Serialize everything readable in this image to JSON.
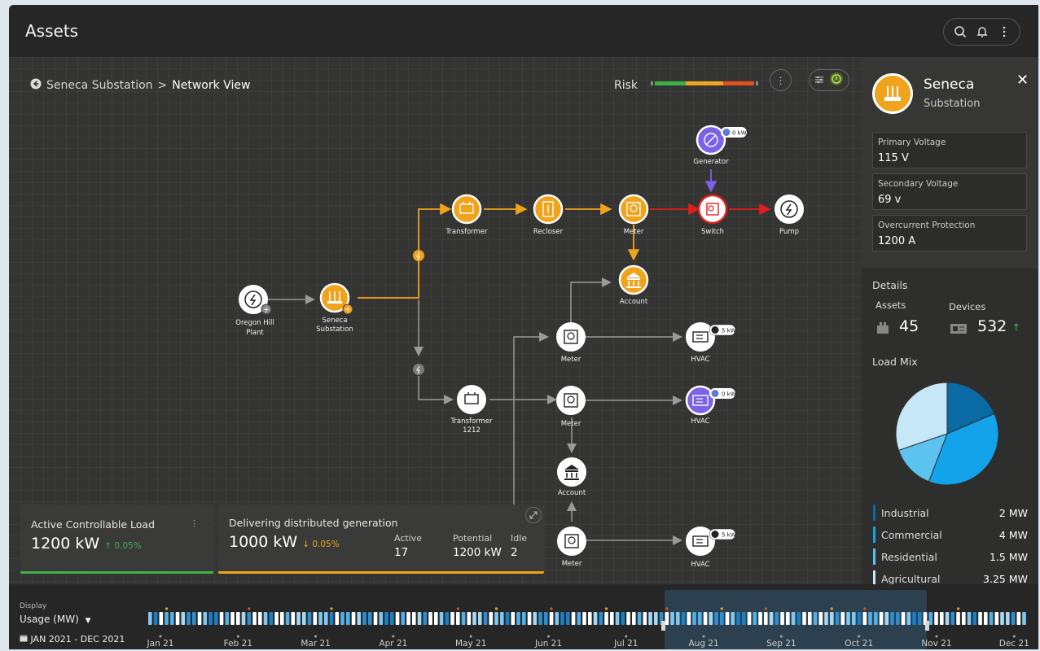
{
  "app": {
    "title": "Assets"
  },
  "breadcrumb": {
    "parent": "Seneca Substation",
    "separator": ">",
    "current": "Network View"
  },
  "risk": {
    "label": "Risk",
    "colors": [
      "#3eb049",
      "#f0a31c",
      "#e5501f"
    ]
  },
  "nodes": {
    "generator": {
      "label": "Generator",
      "badge": "0 kW"
    },
    "transformer": {
      "label": "Transformer"
    },
    "recloser": {
      "label": "Recloser"
    },
    "meter_top": {
      "label": "Meter"
    },
    "switch": {
      "label": "Switch"
    },
    "pump": {
      "label": "Pump"
    },
    "account_top": {
      "label": "Account"
    },
    "oregon_hill": {
      "label_line1": "Oregon Hill",
      "label_line2": "Plant"
    },
    "seneca": {
      "label_line1": "Seneca",
      "label_line2": "Substation"
    },
    "meter1": {
      "label": "Meter"
    },
    "hvac1": {
      "label": "HVAC",
      "badge": "5 kW"
    },
    "transformer1212": {
      "label_line1": "Transformer",
      "label_line2": "1212"
    },
    "meter2": {
      "label": "Meter"
    },
    "hvac2": {
      "label": "HVAC",
      "badge": "0 kW"
    },
    "account_bottom": {
      "label": "Account"
    },
    "meter3": {
      "label": "Meter"
    },
    "hvac3": {
      "label": "HVAC",
      "badge": "5 kW"
    }
  },
  "cards": {
    "controllable": {
      "title": "Active Controllable Load",
      "value": "1200 kW",
      "delta": "↑ 0.05%",
      "delta_color": "#43b049"
    },
    "distributed": {
      "title": "Delivering distributed generation",
      "value": "1000 kW",
      "delta": "↓ 0.05%",
      "delta_color": "#f0a31c",
      "stats": {
        "active_label": "Active",
        "active_value": "17",
        "potential_label": "Potential",
        "potential_value": "1200 kW",
        "idle_label": "Idle",
        "idle_value": "2"
      }
    }
  },
  "panel": {
    "name": "Seneca",
    "type": "Substation",
    "specs": [
      {
        "label": "Primary Voltage",
        "value": "115 V"
      },
      {
        "label": "Secondary Voltage",
        "value": "69 v"
      },
      {
        "label": "Overcurrent Protection",
        "value": "1200 A"
      }
    ],
    "details_heading": "Details",
    "assets_label": "Assets",
    "assets_value": "45",
    "devices_label": "Devices",
    "devices_value": "532",
    "devices_trend": "↑",
    "load_mix_heading": "Load Mix",
    "load_mix": [
      {
        "name": "Industrial",
        "value": "2 MW",
        "amount": 2,
        "color": "#0a6aa3"
      },
      {
        "name": "Commercial",
        "value": "4 MW",
        "amount": 4,
        "color": "#12a3ea"
      },
      {
        "name": "Residential",
        "value": "1.5 MW",
        "amount": 1.5,
        "color": "#5cc3f0"
      },
      {
        "name": "Agricultural",
        "value": "3.25 MW",
        "amount": 3.25,
        "color": "#c6e7f8"
      }
    ]
  },
  "timeline": {
    "display_label": "Display",
    "display_value": "Usage (MW)",
    "range": "JAN 2021 - DEC 2021",
    "months": [
      "Jan 21",
      "Feb 21",
      "Mar 21",
      "Apr 21",
      "May 21",
      "Jun 21",
      "Jul 21",
      "Aug 21",
      "Sep 21",
      "Oct 21",
      "Nov 21",
      "Dec 21"
    ],
    "selected_start": "Aug 21",
    "selected_end": "Nov 21"
  }
}
